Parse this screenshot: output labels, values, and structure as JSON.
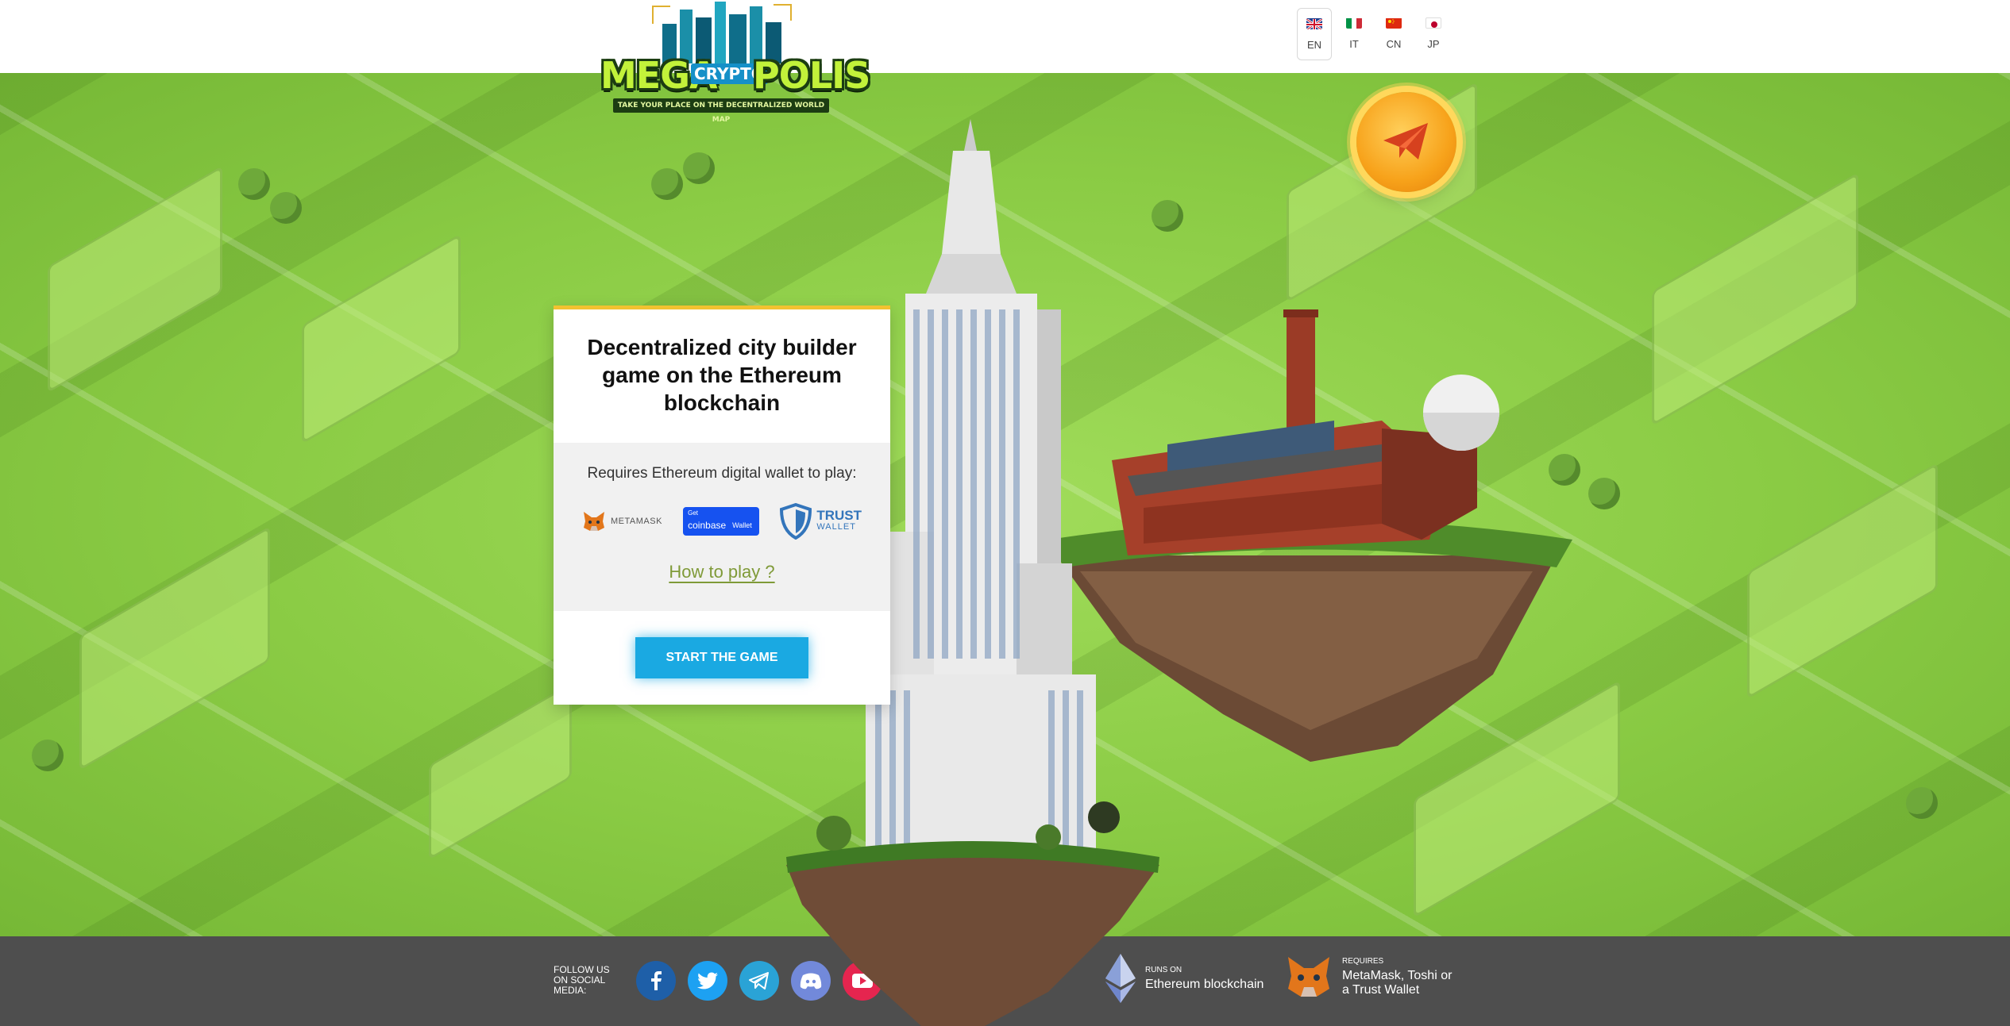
{
  "header": {
    "logo": {
      "word_left": "MEGA",
      "word_middle": "CRYPTO",
      "word_right": "POLIS",
      "tagline": "TAKE YOUR PLACE ON THE DECENTRALIZED WORLD MAP"
    },
    "languages": [
      {
        "code": "EN",
        "active": true
      },
      {
        "code": "IT",
        "active": false
      },
      {
        "code": "CN",
        "active": false
      },
      {
        "code": "JP",
        "active": false
      }
    ]
  },
  "card": {
    "title": "Decentralized city builder game on the Ethereum blockchain",
    "requires": "Requires Ethereum digital wallet to play:",
    "wallets": {
      "metamask": "METAMASK",
      "coinbase_get": "Get",
      "coinbase_name": "coinbase",
      "coinbase_wallet": "Wallet",
      "trust_line1": "TRUST",
      "trust_line2": "WALLET"
    },
    "how_to_play": "How to play ?",
    "start_button": "START THE GAME"
  },
  "footer": {
    "follow": "FOLLOW US ON SOCIAL MEDIA:",
    "socials": [
      "facebook",
      "twitter",
      "telegram",
      "discord",
      "youtube"
    ],
    "runs_on_small": "RUNS ON",
    "runs_on_big": "Ethereum blockchain",
    "requires_small": "REQUIRES",
    "requires_big": "MetaMask, Toshi or a Trust Wallet"
  },
  "colors": {
    "accent_blue": "#1aa9e2",
    "hero_green": "#8ccf45",
    "footer_gray": "#4e4e4e",
    "link_green": "#7f9a38",
    "card_border": "#f2c230"
  }
}
